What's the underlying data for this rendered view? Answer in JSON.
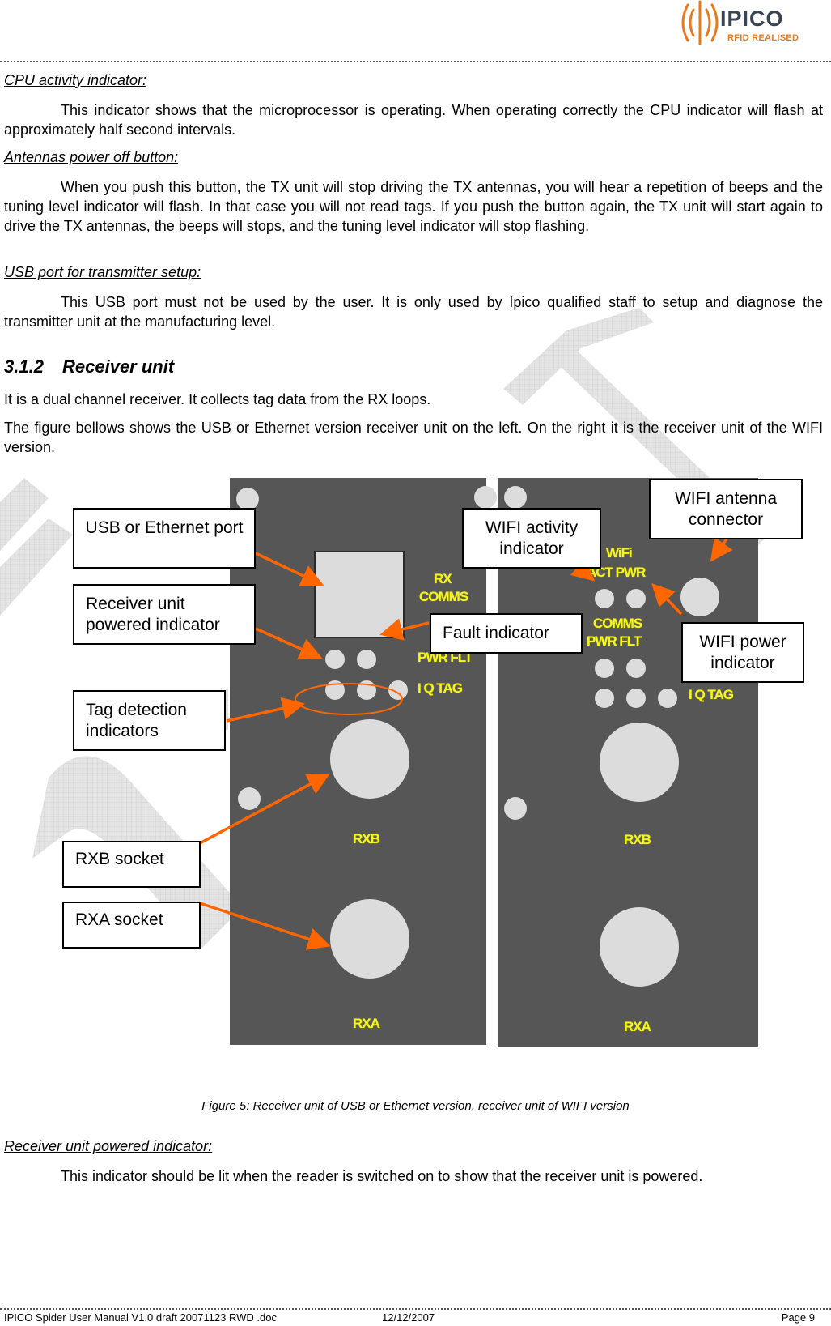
{
  "header": {
    "logo": {
      "icon": "ipico-waves-icon",
      "word": "IPICO",
      "tagline": "RFID REALISED"
    }
  },
  "sections": {
    "cpu": {
      "heading": "CPU activity indicator:",
      "body": "This indicator shows that the microprocessor is operating. When operating correctly the CPU indicator will flash at approximately half second intervals."
    },
    "antennas": {
      "heading": "Antennas power off button:",
      "body": "When you push this button, the TX unit will stop driving the TX antennas, you will hear a repetition of beeps and the tuning level indicator will flash. In that case you will not read tags. If you push the button again, the TX unit will start again to drive the TX antennas, the beeps will stops, and the tuning level indicator will stop flashing."
    },
    "usb": {
      "heading": "USB port for transmitter setup:",
      "body": "This USB port must not be used by the user. It is only used by Ipico qualified staff to setup and diagnose the transmitter unit at the manufacturing level."
    },
    "receiver": {
      "number": "3.1.2",
      "title": "Receiver unit",
      "p1": "It is a dual channel receiver. It collects tag data from the RX loops.",
      "p2": "The figure bellows shows the USB or Ethernet version receiver unit on the left. On the right it is the receiver unit of the WIFI version."
    },
    "powered": {
      "heading": "Receiver unit powered indicator:",
      "body": "This indicator should be lit when the reader is switched on to show that the receiver unit is powered."
    }
  },
  "figure": {
    "left_panel": {
      "labels": {
        "rx": "RX",
        "comms": "COMMS",
        "pwr_flt": "PWR FLT",
        "iq_tag": "I Q TAG",
        "rxb": "RXB",
        "rxa": "RXA"
      }
    },
    "right_panel": {
      "labels": {
        "wifi": "WiFi",
        "act_pwr": "ACT PWR",
        "comms": "COMMS",
        "pwr_flt": "PWR FLT",
        "iq_tag": "I Q TAG",
        "rxb": "RXB",
        "rxa": "RXA"
      }
    },
    "callouts": {
      "usb_port": "USB or Ethernet port",
      "powered": "Receiver unit powered indicator",
      "tag_detection": "Tag detection indicators",
      "rxb": "RXB socket",
      "rxa": "RXA socket",
      "wifi_activity": "WIFI activity indicator",
      "fault": "Fault indicator",
      "wifi_antenna": "WIFI antenna connector",
      "wifi_power": "WIFI power indicator"
    },
    "caption": "Figure 5:  Receiver unit of USB or Ethernet version, receiver unit of WIFI version",
    "colors": {
      "panel": "#565656",
      "component": "#dcdcdc",
      "label": "#f5f51a",
      "arrow": "#ff6600"
    }
  },
  "footer": {
    "document": "IPICO Spider User Manual V1.0 draft 20071123 RWD .doc",
    "date": "12/12/2007",
    "page": "Page 9"
  },
  "watermark": {
    "text": "DRAFT"
  }
}
